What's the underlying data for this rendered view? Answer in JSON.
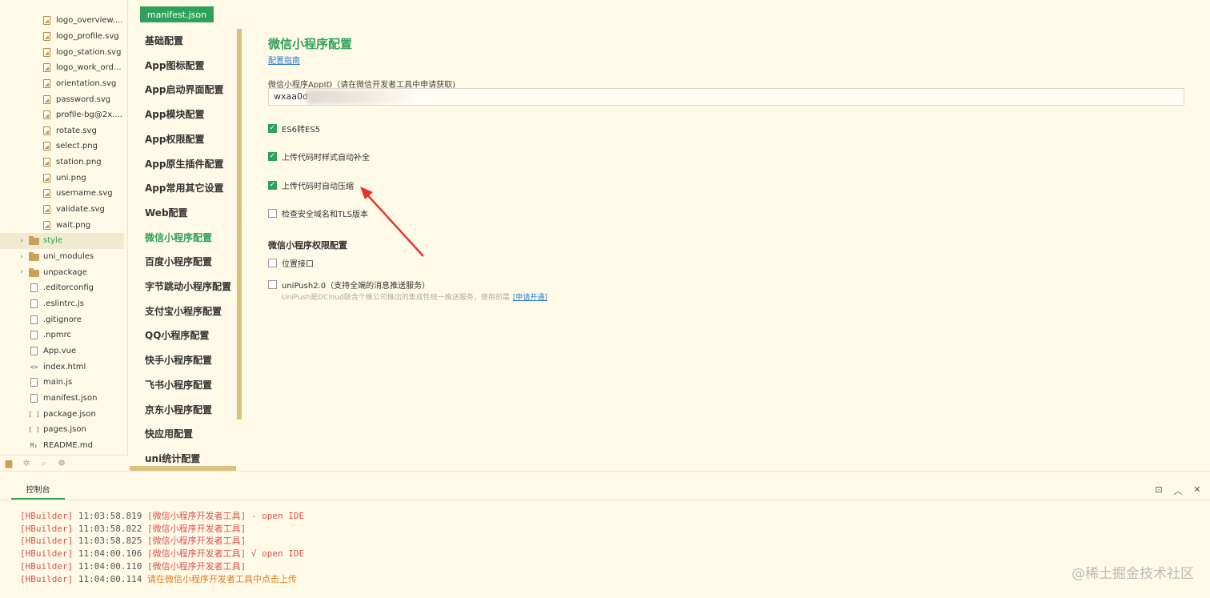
{
  "file_tree": {
    "items": [
      {
        "label": "logo_overview....",
        "icon": "image-file-icon",
        "indent": 2
      },
      {
        "label": "logo_profile.svg",
        "icon": "image-file-icon",
        "indent": 2
      },
      {
        "label": "logo_station.svg",
        "icon": "image-file-icon",
        "indent": 2
      },
      {
        "label": "logo_work_ord...",
        "icon": "image-file-icon",
        "indent": 2
      },
      {
        "label": "orientation.svg",
        "icon": "image-file-icon",
        "indent": 2
      },
      {
        "label": "password.svg",
        "icon": "image-file-icon",
        "indent": 2
      },
      {
        "label": "profile-bg@2x....",
        "icon": "image-file-icon",
        "indent": 2
      },
      {
        "label": "rotate.svg",
        "icon": "image-file-icon",
        "indent": 2
      },
      {
        "label": "select.png",
        "icon": "image-file-icon",
        "indent": 2
      },
      {
        "label": "station.png",
        "icon": "image-file-icon",
        "indent": 2
      },
      {
        "label": "uni.png",
        "icon": "image-file-icon",
        "indent": 2
      },
      {
        "label": "username.svg",
        "icon": "image-file-icon",
        "indent": 2
      },
      {
        "label": "validate.svg",
        "icon": "image-file-icon",
        "indent": 2
      },
      {
        "label": "wait.png",
        "icon": "image-file-icon",
        "indent": 2
      },
      {
        "label": "style",
        "icon": "folder-icon",
        "indent": 1,
        "chevron": "›",
        "active": true
      },
      {
        "label": "uni_modules",
        "icon": "folder-icon",
        "indent": 1,
        "chevron": "›"
      },
      {
        "label": "unpackage",
        "icon": "folder-icon",
        "indent": 1,
        "chevron": "›"
      },
      {
        "label": ".editorconfig",
        "icon": "file-icon",
        "indent": 1
      },
      {
        "label": ".eslintrc.js",
        "icon": "file-icon",
        "indent": 1
      },
      {
        "label": ".gitignore",
        "icon": "file-icon",
        "indent": 1
      },
      {
        "label": ".npmrc",
        "icon": "file-icon",
        "indent": 1
      },
      {
        "label": "App.vue",
        "icon": "file-icon",
        "indent": 1
      },
      {
        "label": "index.html",
        "icon": "code-file-icon",
        "glyph": "<>",
        "indent": 1
      },
      {
        "label": "main.js",
        "icon": "file-icon",
        "indent": 1
      },
      {
        "label": "manifest.json",
        "icon": "json-file-icon",
        "indent": 1
      },
      {
        "label": "package.json",
        "icon": "bracket-file-icon",
        "glyph": "[ ]",
        "indent": 1
      },
      {
        "label": "pages.json",
        "icon": "bracket-file-icon",
        "glyph": "[ ]",
        "indent": 1
      },
      {
        "label": "README.md",
        "icon": "markdown-file-icon",
        "glyph": "M↓",
        "indent": 1
      }
    ]
  },
  "editor": {
    "tab_label": "manifest.json"
  },
  "settings_nav": {
    "items": [
      {
        "label": "基础配置"
      },
      {
        "label": "App图标配置"
      },
      {
        "label": "App启动界面配置"
      },
      {
        "label": "App模块配置"
      },
      {
        "label": "App权限配置"
      },
      {
        "label": "App原生插件配置"
      },
      {
        "label": "App常用其它设置"
      },
      {
        "label": "Web配置"
      },
      {
        "label": "微信小程序配置",
        "active": true
      },
      {
        "label": "百度小程序配置"
      },
      {
        "label": "字节跳动小程序配置"
      },
      {
        "label": "支付宝小程序配置"
      },
      {
        "label": "QQ小程序配置"
      },
      {
        "label": "快手小程序配置"
      },
      {
        "label": "飞书小程序配置"
      },
      {
        "label": "京东小程序配置"
      },
      {
        "label": "快应用配置"
      },
      {
        "label": "uni统计配置"
      }
    ]
  },
  "panel": {
    "title": "微信小程序配置",
    "guide_link": "配置指南",
    "appid_label": "微信小程序AppID（请在微信开发者工具中申请获取)",
    "appid_value": "wxaa0df(",
    "options": [
      {
        "label": "ES6转ES5",
        "checked": true
      },
      {
        "label": "上传代码时样式自动补全",
        "checked": true
      },
      {
        "label": "上传代码时自动压缩",
        "checked": true
      },
      {
        "label": "检查安全域名和TLS版本",
        "checked": false
      }
    ],
    "permissions_heading": "微信小程序权限配置",
    "permissions": [
      {
        "label": "位置接口",
        "checked": false
      },
      {
        "label": "uniPush2.0（支持全端的消息推送服务）",
        "checked": false
      }
    ],
    "unipush_note": "UniPush是DCloud联合个推公司推出的集成性统一推送服务，使用前需",
    "unipush_link": "[申请开通]",
    "annotation_color": "#e8352b"
  },
  "console": {
    "tab_label": "控制台",
    "lines": [
      {
        "tag": "[HBuilder]",
        "time": "11:03:58.819",
        "msg": "[微信小程序开发者工具] - open IDE"
      },
      {
        "tag": "[HBuilder]",
        "time": "11:03:58.822",
        "msg": "[微信小程序开发者工具]"
      },
      {
        "tag": "[HBuilder]",
        "time": "11:03:58.825",
        "msg": "[微信小程序开发者工具]"
      },
      {
        "tag": "[HBuilder]",
        "time": "11:04:00.106",
        "msg": "[微信小程序开发者工具] √ open IDE"
      },
      {
        "tag": "[HBuilder]",
        "time": "11:04:00.110",
        "msg": "[微信小程序开发者工具]"
      },
      {
        "tag": "[HBuilder]",
        "time": "11:04:00.114",
        "msg": "请在微信小程序开发者工具中点击上传"
      }
    ]
  },
  "watermark": "@稀土掘金技术社区",
  "colors": {
    "accent": "#2fa15a",
    "background": "#fffae8",
    "log_red": "#d9534f",
    "log_orange": "#e07c24"
  }
}
